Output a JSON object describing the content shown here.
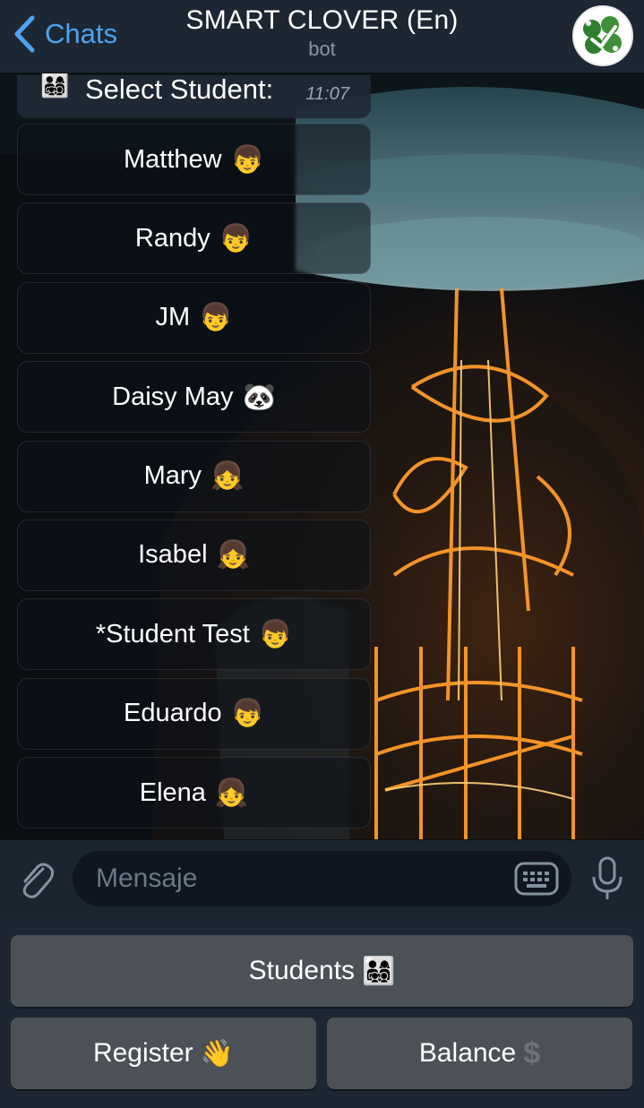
{
  "header": {
    "back_label": "Chats",
    "title": "SMART CLOVER (En)",
    "subtitle": "bot"
  },
  "message": {
    "emoji": "👨‍👩‍👧‍👦",
    "text": "Select Student:",
    "time": "11:07"
  },
  "inline_keyboard": [
    {
      "label": "Matthew",
      "emoji": "👦"
    },
    {
      "label": "Randy",
      "emoji": "👦"
    },
    {
      "label": "JM",
      "emoji": "👦"
    },
    {
      "label": "Daisy May",
      "emoji": "🐼"
    },
    {
      "label": "Mary",
      "emoji": "👧"
    },
    {
      "label": "Isabel",
      "emoji": "👧"
    },
    {
      "label": "*Student Test",
      "emoji": "👦"
    },
    {
      "label": "Eduardo",
      "emoji": "👦"
    },
    {
      "label": "Elena",
      "emoji": "👧"
    }
  ],
  "input": {
    "placeholder": "Mensaje"
  },
  "reply_keyboard": {
    "students": {
      "label": "Students",
      "emoji": "👨‍👩‍👧‍👦"
    },
    "register": {
      "label": "Register",
      "emoji": "👋"
    },
    "balance": {
      "label": "Balance",
      "emoji": "$"
    }
  },
  "icons": {
    "back": "chevron-left-icon",
    "attach": "paperclip-icon",
    "keyboard": "keyboard-icon",
    "mic": "microphone-icon",
    "avatar": "clover-logo"
  },
  "colors": {
    "accent": "#4ca3f0",
    "header_bg": "#1d2733",
    "reply_button": "#4b5157"
  }
}
